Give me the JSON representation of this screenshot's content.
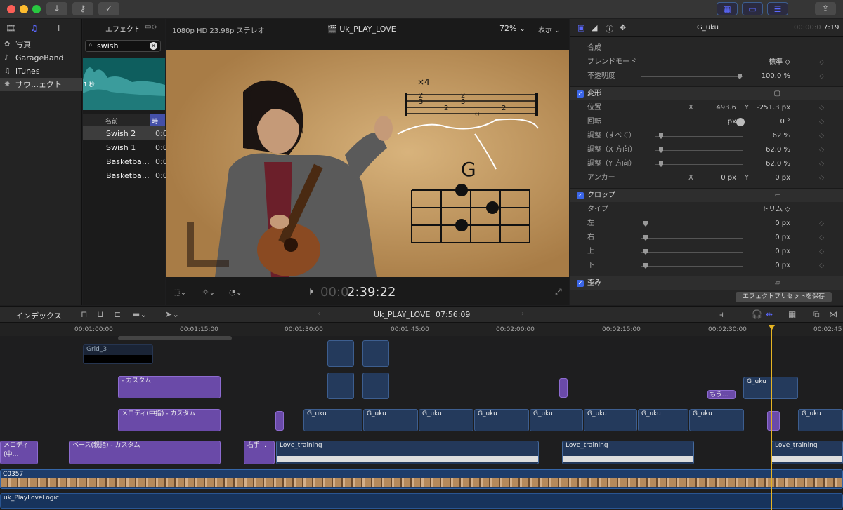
{
  "toolbar": {
    "import_icon": "download-arrow",
    "keys_icon": "key",
    "check_icon": "check-circle",
    "share_icon": "share"
  },
  "library": {
    "items": [
      {
        "label": "写真",
        "icon": "photos-icon"
      },
      {
        "label": "GarageBand",
        "icon": "guitar-icon"
      },
      {
        "label": "iTunes",
        "icon": "music-note-icon"
      },
      {
        "label": "サウ…ェクト",
        "icon": "burst-icon"
      }
    ]
  },
  "browser": {
    "title": "エフェクト",
    "search_value": "swish",
    "thumb_label": "1 秒",
    "col_name": "名前",
    "col_time": "時間",
    "rows": [
      {
        "name": "Swish 2",
        "time": "0:0"
      },
      {
        "name": "Swish 1",
        "time": "0:0"
      },
      {
        "name": "Basketba…",
        "time": "0:0"
      },
      {
        "name": "Basketba…",
        "time": "0:0"
      }
    ]
  },
  "viewer": {
    "format": "1080p HD 23.98p ステレオ",
    "project": "Uk_PLAY_LOVE",
    "zoom": "72%",
    "view": "表示",
    "timecode_dim": "00:0",
    "timecode": "2:39:22",
    "chord": "G",
    "times": "×4"
  },
  "inspector": {
    "clip_name": "G_uku",
    "duration_dim": "00:00:0",
    "duration": "7:19",
    "composite": "合成",
    "blend_label": "ブレンドモード",
    "blend_value": "標準 ◇",
    "opacity_label": "不透明度",
    "opacity_value": "100.0 %",
    "transform": "変形",
    "pos_label": "位置",
    "pos_x_lbl": "X",
    "pos_x": "493.6 px",
    "pos_y_lbl": "Y",
    "pos_y": "-251.3 px",
    "rot_label": "回転",
    "rot_value": "0 °",
    "scale_all_label": "調整（すべて）",
    "scale_all": "62 %",
    "scale_x_label": "調整（X 方向）",
    "scale_x": "62.0 %",
    "scale_y_label": "調整（Y 方向）",
    "scale_y": "62.0 %",
    "anchor_label": "アンカー",
    "anchor_x_lbl": "X",
    "anchor_x": "0 px",
    "anchor_y_lbl": "Y",
    "anchor_y": "0 px",
    "crop": "クロップ",
    "type_label": "タイプ",
    "type_value": "トリム ◇",
    "left_label": "左",
    "left_value": "0 px",
    "right_label": "右",
    "right_value": "0 px",
    "top_label": "上",
    "top_value": "0 px",
    "bottom_label": "下",
    "bottom_value": "0 px",
    "distort": "歪み",
    "save_preset": "エフェクトプリセットを保存"
  },
  "timeline": {
    "index": "インデックス",
    "project": "Uk_PLAY_LOVE",
    "duration": "07:56:09",
    "ruler": [
      "00:01:00:00",
      "00:01:15:00",
      "00:01:30:00",
      "00:01:45:00",
      "00:02:00:00",
      "00:02:15:00",
      "00:02:30:00",
      "00:02:45"
    ],
    "clips": {
      "grid": "Grid_3",
      "custom": "- カスタム",
      "melody": "メロディ(中指) - カスタム",
      "melody_short": "メロディ(中…",
      "bass": "ベース(親指) - カスタム",
      "right": "右手…",
      "love": "Love_training",
      "guku": "G_uku",
      "more": "もう…",
      "c0357": "C0357",
      "logic": "uk_PlayLoveLogic"
    }
  }
}
